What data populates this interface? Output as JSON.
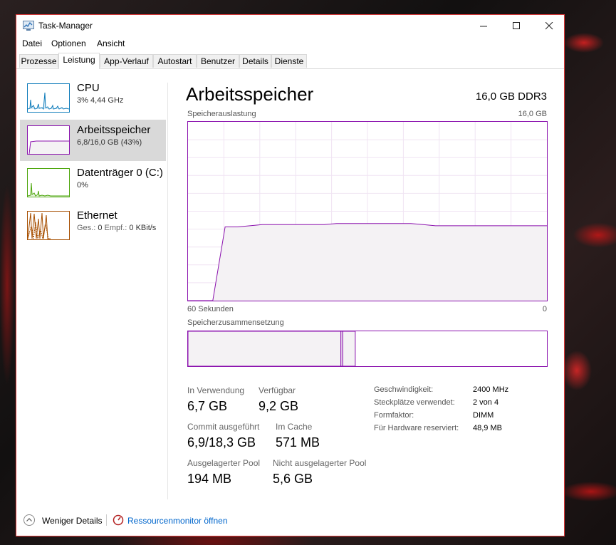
{
  "window": {
    "title": "Task-Manager",
    "controls": {
      "minimize": "—",
      "maximize": "☐",
      "close": "✕"
    }
  },
  "menu": [
    "Datei",
    "Optionen",
    "Ansicht"
  ],
  "tabs": [
    "Prozesse",
    "Leistung",
    "App-Verlauf",
    "Autostart",
    "Benutzer",
    "Details",
    "Dienste"
  ],
  "active_tab": "Leistung",
  "sidebar": {
    "items": [
      {
        "name": "CPU",
        "sub": "3%  4,44 GHz",
        "color": "#117dbb"
      },
      {
        "name": "Arbeitsspeicher",
        "sub": "6,8/16,0 GB (43%)",
        "color": "#8b12ae",
        "selected": true
      },
      {
        "name": "Datenträger 0 (C:)",
        "sub": "0%",
        "color": "#4da60c"
      },
      {
        "name": "Ethernet",
        "sub_send_label": "Ges.:",
        "sub_send": "0",
        "sub_recv_label": "Empf.:",
        "sub_recv": "0 KBit/s",
        "color": "#a74f01"
      }
    ]
  },
  "main": {
    "title": "Arbeitsspeicher",
    "capacity": "16,0 GB DDR3",
    "usage_label": "Speicherauslastung",
    "usage_max": "16,0 GB",
    "time_left": "60 Sekunden",
    "time_right": "0",
    "composition_label": "Speicherzusammensetzung",
    "accent": "#8b12ae"
  },
  "usage_graph": {
    "y_max_gb": 16.0,
    "values_gb": [
      0,
      0,
      0,
      6.6,
      6.6,
      6.7,
      6.8,
      6.8,
      6.8,
      6.8,
      6.8,
      6.8,
      6.9,
      6.9,
      6.9,
      6.9,
      6.9,
      6.9,
      6.9,
      6.8,
      6.7,
      6.7,
      6.7,
      6.7,
      6.7,
      6.7,
      6.7,
      6.7,
      6.7,
      6.7
    ]
  },
  "composition": {
    "in_use_fraction": 0.426,
    "modified_fraction": 0.005,
    "standby_fraction": 0.035
  },
  "stats": {
    "in_use_label": "In Verwendung",
    "in_use": "6,7 GB",
    "available_label": "Verfügbar",
    "available": "9,2 GB",
    "committed_label": "Commit ausgeführt",
    "committed": "6,9/18,3 GB",
    "cached_label": "Im Cache",
    "cached": "571 MB",
    "paged_label": "Ausgelagerter Pool",
    "paged": "194 MB",
    "nonpaged_label": "Nicht ausgelagerter Pool",
    "nonpaged": "5,6 GB"
  },
  "specs": {
    "speed_label": "Geschwindigkeit:",
    "speed": "2400 MHz",
    "slots_label": "Steckplätze verwendet:",
    "slots": "2 von 4",
    "form_label": "Formfaktor:",
    "form": "DIMM",
    "reserved_label": "Für Hardware reserviert:",
    "reserved": "48,9 MB"
  },
  "footer": {
    "fewer_details": "Weniger Details",
    "resource_monitor": "Ressourcenmonitor öffnen"
  }
}
